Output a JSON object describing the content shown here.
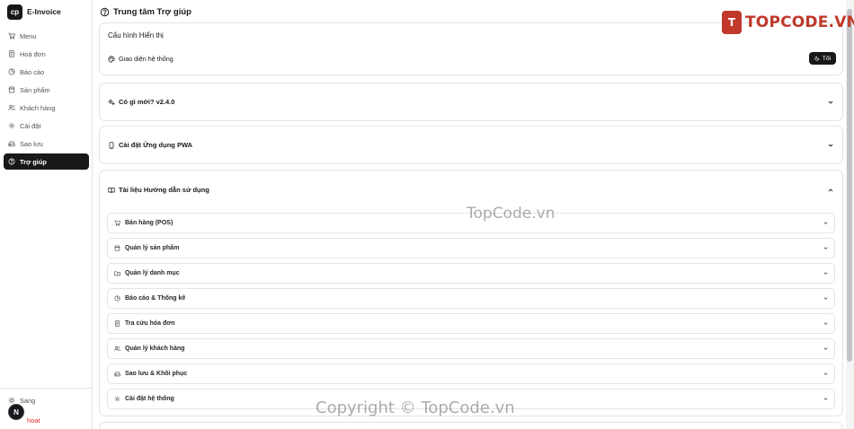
{
  "brand": {
    "logo_text": "cp",
    "name": "E-Invoice"
  },
  "nav": {
    "items": [
      {
        "label": "Menu",
        "icon": "cart-icon",
        "active": false
      },
      {
        "label": "Hoá đơn",
        "icon": "receipt-icon",
        "active": false
      },
      {
        "label": "Báo cáo",
        "icon": "chart-icon",
        "active": false
      },
      {
        "label": "Sản phẩm",
        "icon": "store-icon",
        "active": false
      },
      {
        "label": "Khách hàng",
        "icon": "users-icon",
        "active": false
      },
      {
        "label": "Cài đặt",
        "icon": "gear-icon",
        "active": false
      },
      {
        "label": "Sao lưu",
        "icon": "drive-icon",
        "active": false
      },
      {
        "label": "Trợ giúp",
        "icon": "help-circle-icon",
        "active": true
      }
    ]
  },
  "footer": {
    "theme_label": "Sang",
    "logout_label": "hoat",
    "avatar_text": "N"
  },
  "header": {
    "title": "Trung tâm Trợ giúp"
  },
  "display_config": {
    "title": "Cấu hình Hiển thị",
    "theme_row_label": "Giao diện hệ thống",
    "theme_button": "Tối"
  },
  "whats_new": {
    "label": "Có gì mới? v2.4.0"
  },
  "pwa": {
    "label": "Cài đặt Ứng dụng PWA"
  },
  "guide": {
    "label": "Tài liệu Hướng dẫn sử dụng",
    "items": [
      {
        "label": "Bán hàng (POS)",
        "icon": "cart-icon"
      },
      {
        "label": "Quản lý sản phẩm",
        "icon": "store-icon"
      },
      {
        "label": "Quản lý danh mục",
        "icon": "folder-icon"
      },
      {
        "label": "Báo cáo & Thống kê",
        "icon": "chart-icon"
      },
      {
        "label": "Tra cứu hóa đơn",
        "icon": "receipt-icon"
      },
      {
        "label": "Quản lý khách hàng",
        "icon": "users-icon"
      },
      {
        "label": "Sao lưu & Khôi phục",
        "icon": "drive-icon"
      },
      {
        "label": "Cài đặt hệ thống",
        "icon": "gear-icon"
      }
    ]
  },
  "watermarks": {
    "logo_mark": "T",
    "logo_text": "TOPCODE.VN",
    "center": "TopCode.vn",
    "bottom": "Copyright © TopCode.vn"
  },
  "colors": {
    "accent": "#18181b",
    "border": "#e4e4e7",
    "logout": "#dc2626",
    "watermark_logo": "#c0392b"
  }
}
